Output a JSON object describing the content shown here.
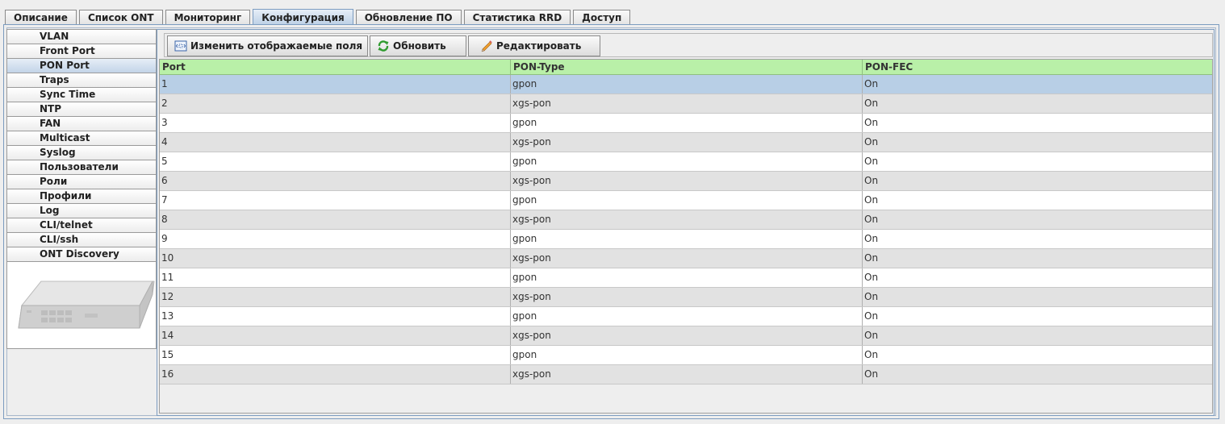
{
  "tabs": [
    {
      "label": "Описание"
    },
    {
      "label": "Список ONT"
    },
    {
      "label": "Мониторинг"
    },
    {
      "label": "Конфигурация",
      "active": true
    },
    {
      "label": "Обновление ПО"
    },
    {
      "label": "Статистика RRD"
    },
    {
      "label": "Доступ"
    }
  ],
  "sidebar": {
    "items": [
      {
        "label": "VLAN"
      },
      {
        "label": "Front Port"
      },
      {
        "label": "PON Port",
        "active": true
      },
      {
        "label": "Traps"
      },
      {
        "label": "Sync Time"
      },
      {
        "label": "NTP"
      },
      {
        "label": "FAN"
      },
      {
        "label": "Multicast"
      },
      {
        "label": "Syslog"
      },
      {
        "label": "Пользователи"
      },
      {
        "label": "Роли"
      },
      {
        "label": "Профили"
      },
      {
        "label": "Log"
      },
      {
        "label": "CLI/telnet"
      },
      {
        "label": "CLI/ssh"
      },
      {
        "label": "ONT Discovery"
      }
    ]
  },
  "toolbar": {
    "fields_label": "Изменить отображаемые поля",
    "refresh_label": "Обновить",
    "edit_label": "Редактировать"
  },
  "table": {
    "columns": [
      "Port",
      "PON-Type",
      "PON-FEC"
    ],
    "rows": [
      [
        "1",
        "gpon",
        "On"
      ],
      [
        "2",
        "xgs-pon",
        "On"
      ],
      [
        "3",
        "gpon",
        "On"
      ],
      [
        "4",
        "xgs-pon",
        "On"
      ],
      [
        "5",
        "gpon",
        "On"
      ],
      [
        "6",
        "xgs-pon",
        "On"
      ],
      [
        "7",
        "gpon",
        "On"
      ],
      [
        "8",
        "xgs-pon",
        "On"
      ],
      [
        "9",
        "gpon",
        "On"
      ],
      [
        "10",
        "xgs-pon",
        "On"
      ],
      [
        "11",
        "gpon",
        "On"
      ],
      [
        "12",
        "xgs-pon",
        "On"
      ],
      [
        "13",
        "gpon",
        "On"
      ],
      [
        "14",
        "xgs-pon",
        "On"
      ],
      [
        "15",
        "gpon",
        "On"
      ],
      [
        "16",
        "xgs-pon",
        "On"
      ]
    ],
    "selected_row": "1"
  },
  "colors": {
    "header_bg": "#b9f0a8",
    "selection": "#b8cfe6",
    "accent_border": "#7c9cc0"
  }
}
